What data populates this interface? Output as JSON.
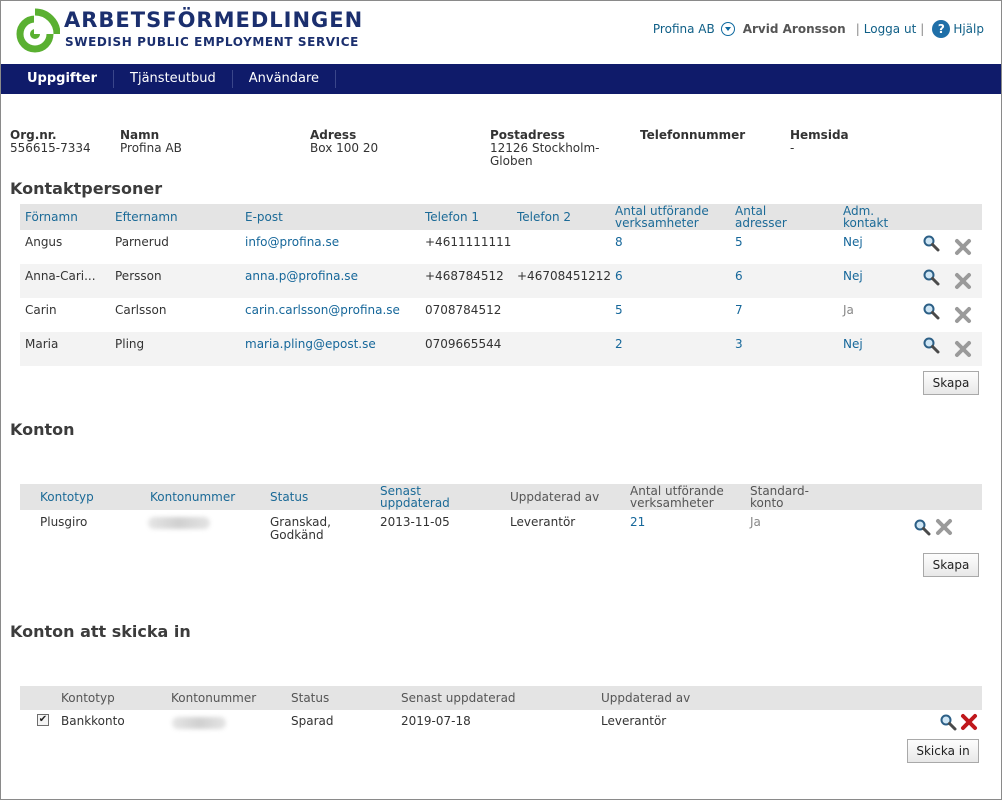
{
  "header": {
    "brand_name": "ARBETSFÖRMEDLINGEN",
    "brand_subtitle": "SWEDISH PUBLIC EMPLOYMENT SERVICE",
    "org_selector": "Profina AB",
    "user_name": "Arvid Aronsson",
    "logout_label": "Logga ut",
    "help_label": "Hjälp",
    "separator": "|"
  },
  "nav": {
    "items": [
      "Uppgifter",
      "Tjänsteutbud",
      "Användare"
    ]
  },
  "company": {
    "orgnr_label": "Org.nr.",
    "orgnr_value": "556615-7334",
    "name_label": "Namn",
    "name_value": "Profina AB",
    "address_label": "Adress",
    "address_value": "Box 100 20",
    "postal_label": "Postadress",
    "postal_value_1": "12126 Stockholm-",
    "postal_value_2": "Globen",
    "phone_label": "Telefonnummer",
    "phone_value": "",
    "web_label": "Hemsida",
    "web_value": "-"
  },
  "contacts": {
    "title": "Kontaktpersoner",
    "headers": {
      "first": "Förnamn",
      "last": "Efternamn",
      "email": "E-post",
      "phone1": "Telefon 1",
      "phone2": "Telefon 2",
      "count_units_1": "Antal utförande",
      "count_units_2": "verksamheter",
      "count_addr_1": "Antal",
      "count_addr_2": "adresser",
      "admin_1": "Adm.",
      "admin_2": "kontakt"
    },
    "rows": [
      {
        "first": "Angus",
        "last": "Parnerud",
        "email": "info@profina.se",
        "phone1": "+4611111111",
        "phone2": "",
        "units": "8",
        "addresses": "5",
        "admin": "Nej"
      },
      {
        "first": "Anna-Cari...",
        "last": "Persson",
        "email": "anna.p@profina.se",
        "phone1": "+468784512",
        "phone2": "+46708451212",
        "units": "6",
        "addresses": "6",
        "admin": "Nej"
      },
      {
        "first": "Carin",
        "last": "Carlsson",
        "email": "carin.carlsson@profina.se",
        "phone1": "0708784512",
        "phone2": "",
        "units": "5",
        "addresses": "7",
        "admin": "Ja"
      },
      {
        "first": "Maria",
        "last": "Pling",
        "email": "maria.pling@epost.se",
        "phone1": "0709665544",
        "phone2": "",
        "units": "2",
        "addresses": "3",
        "admin": "Nej"
      }
    ],
    "create_label": "Skapa"
  },
  "accounts": {
    "title": "Konton",
    "headers": {
      "type": "Kontotyp",
      "number": "Kontonummer",
      "status": "Status",
      "updated_1": "Senast",
      "updated_2": "uppdaterad",
      "updated_by": "Uppdaterad av",
      "units_1": "Antal utförande",
      "units_2": "verksamheter",
      "standard_1": "Standard-",
      "standard_2": "konto"
    },
    "rows": [
      {
        "type": "Plusgiro",
        "status_1": "Granskad,",
        "status_2": "Godkänd",
        "updated": "2013-11-05",
        "updated_by": "Leverantör",
        "units": "21",
        "standard": "Ja"
      }
    ],
    "create_label": "Skapa"
  },
  "submit_accounts": {
    "title": "Konton att skicka in",
    "headers": {
      "type": "Kontotyp",
      "number": "Kontonummer",
      "status": "Status",
      "updated": "Senast uppdaterad",
      "updated_by": "Uppdaterad av"
    },
    "rows": [
      {
        "checked": "✔",
        "type": "Bankkonto",
        "status": "Sparad",
        "updated": "2019-07-18",
        "updated_by": "Leverantör"
      }
    ],
    "submit_label": "Skicka in"
  },
  "colors": {
    "nav_bg": "#0f1b6a",
    "brand": "#1b2f6e",
    "link": "#16679a",
    "logo_green": "#5ab031",
    "delete_red": "#c0171c"
  }
}
